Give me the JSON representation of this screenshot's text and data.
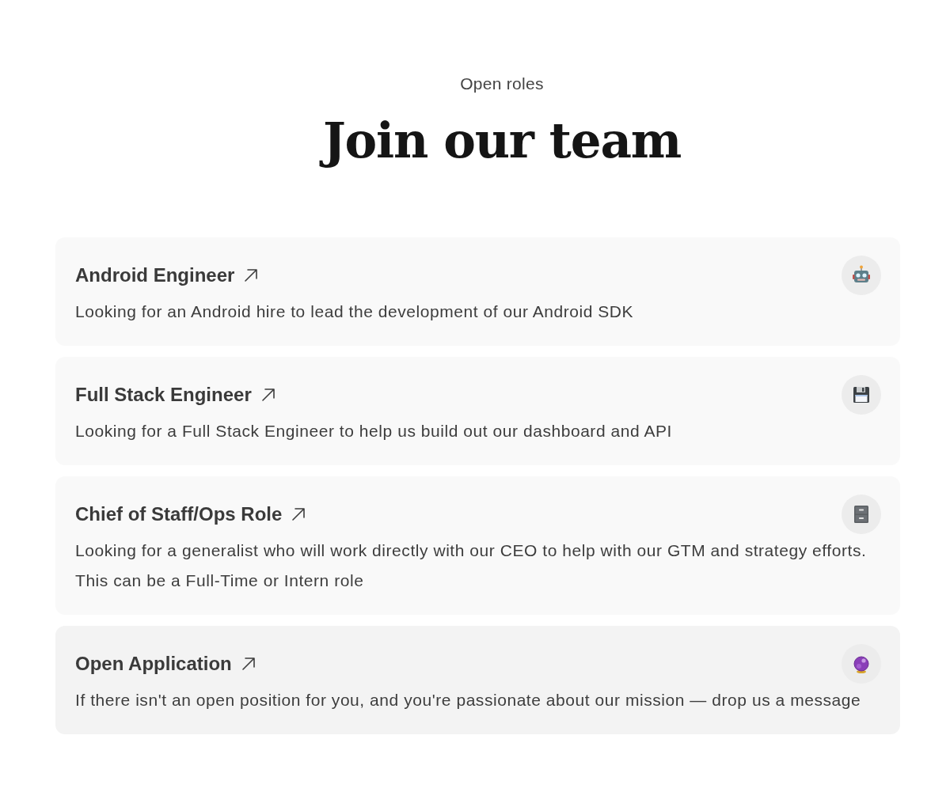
{
  "header": {
    "eyebrow": "Open roles",
    "title": "Join our team"
  },
  "roles": [
    {
      "title": "Android Engineer",
      "description": "Looking for an Android hire to lead the development of our Android SDK",
      "color": "#f9f9f9"
    },
    {
      "title": "Full Stack Engineer",
      "description": "Looking for a Full Stack Engineer to help us build out our dashboard and API",
      "color": "#f9f9f9"
    },
    {
      "title": "Chief of Staff/Ops Role",
      "description": "Looking for a generalist who will work directly with our CEO to help with our GTM and strategy efforts. This can be a Full-Time or Intern role",
      "color": "#f9f9f9"
    },
    {
      "title": "Open Application",
      "description": "If there isn't an open position for you, and you're passionate about our mission — drop us a message",
      "color": "#f3f3f3"
    }
  ]
}
